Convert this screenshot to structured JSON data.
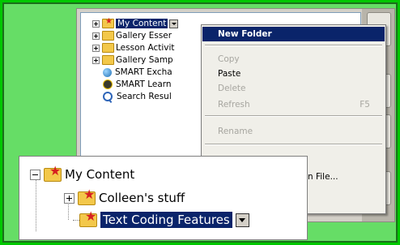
{
  "tree": {
    "items": [
      {
        "label": "My Content",
        "icon": "star-folder-icon",
        "expander": "plus",
        "selected": true
      },
      {
        "label": "Gallery Esser",
        "icon": "folder-icon",
        "expander": "plus"
      },
      {
        "label": "Lesson Activit",
        "icon": "folder-icon",
        "expander": "plus"
      },
      {
        "label": "Gallery Samp",
        "icon": "folder-icon",
        "expander": "plus"
      },
      {
        "label": "SMART Excha",
        "icon": "globe-icon"
      },
      {
        "label": "SMART Learn",
        "icon": "badge-icon"
      },
      {
        "label": "Search Resul",
        "icon": "search-icon"
      }
    ]
  },
  "context_menu": {
    "items": [
      {
        "label": "New Folder",
        "state": "highlighted"
      },
      {
        "label": "Copy",
        "state": "disabled"
      },
      {
        "label": "Paste",
        "state": "enabled"
      },
      {
        "label": "Delete",
        "state": "disabled"
      },
      {
        "label": "Refresh",
        "state": "disabled",
        "shortcut": "F5"
      },
      {
        "label": "Rename",
        "state": "disabled"
      }
    ],
    "partial_texts": [
      ".",
      "n File..."
    ]
  },
  "zoom": {
    "items": [
      {
        "label": "My Content",
        "expander": "minus"
      },
      {
        "label": "Colleen's stuff",
        "expander": "plus"
      },
      {
        "label": "Text Coding Features",
        "selected": true
      }
    ]
  },
  "colors": {
    "frame_green": "#00c800",
    "selection_blue": "#0a246a",
    "folder_yellow": "#f3c84a",
    "star_red": "#d62020"
  }
}
